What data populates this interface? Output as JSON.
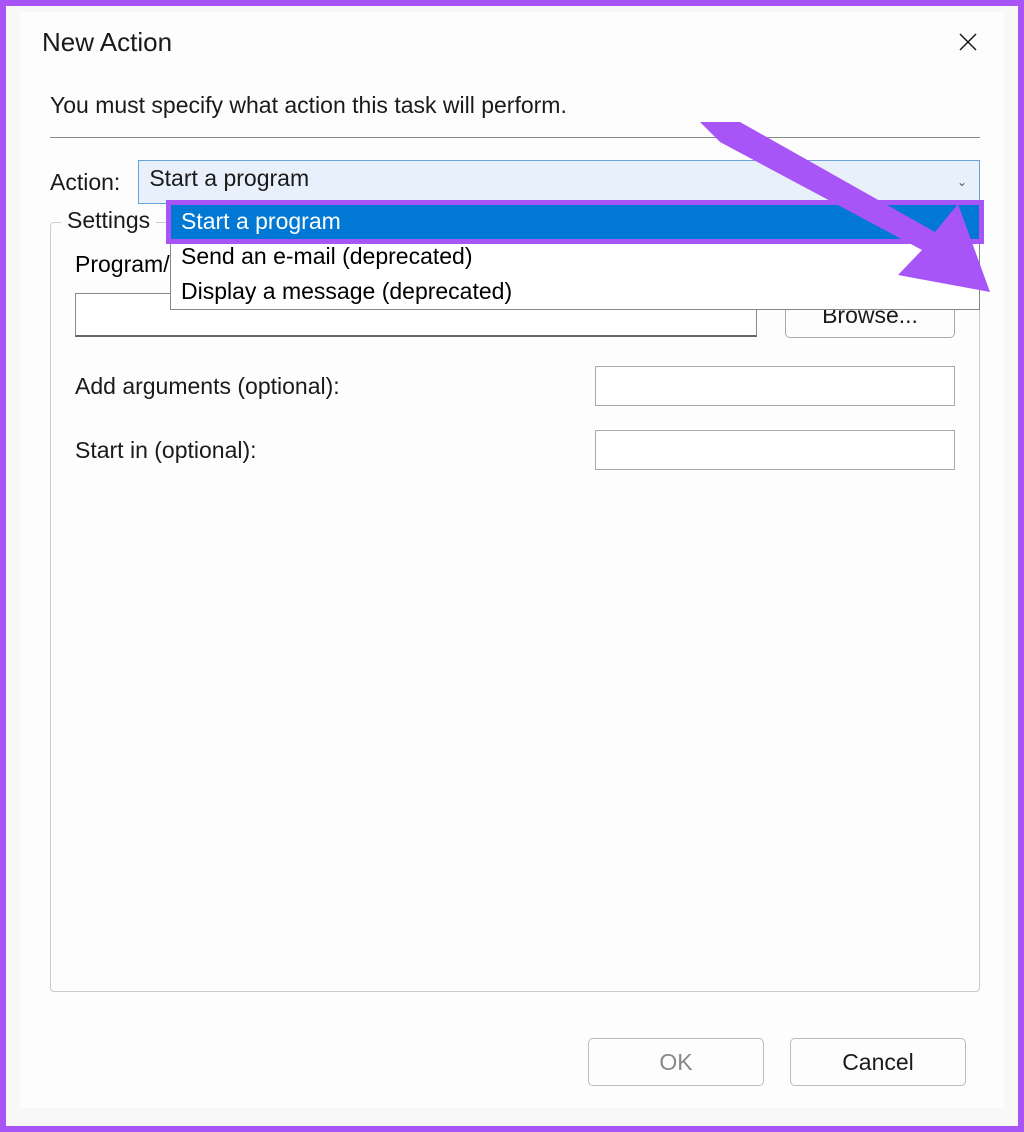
{
  "dialog": {
    "title": "New Action",
    "instruction": "You must specify what action this task will perform.",
    "action_label": "Action:",
    "action_selected": "Start a program",
    "action_options": [
      "Start a program",
      "Send an e-mail (deprecated)",
      "Display a message (deprecated)"
    ],
    "settings_legend": "Settings",
    "program_label": "Program/script:",
    "program_value": "",
    "browse_label": "Browse...",
    "add_args_label": "Add arguments (optional):",
    "add_args_value": "",
    "start_in_label": "Start in (optional):",
    "start_in_value": "",
    "ok_label": "OK",
    "cancel_label": "Cancel"
  },
  "annotation": {
    "arrow_color": "#a855f7"
  }
}
